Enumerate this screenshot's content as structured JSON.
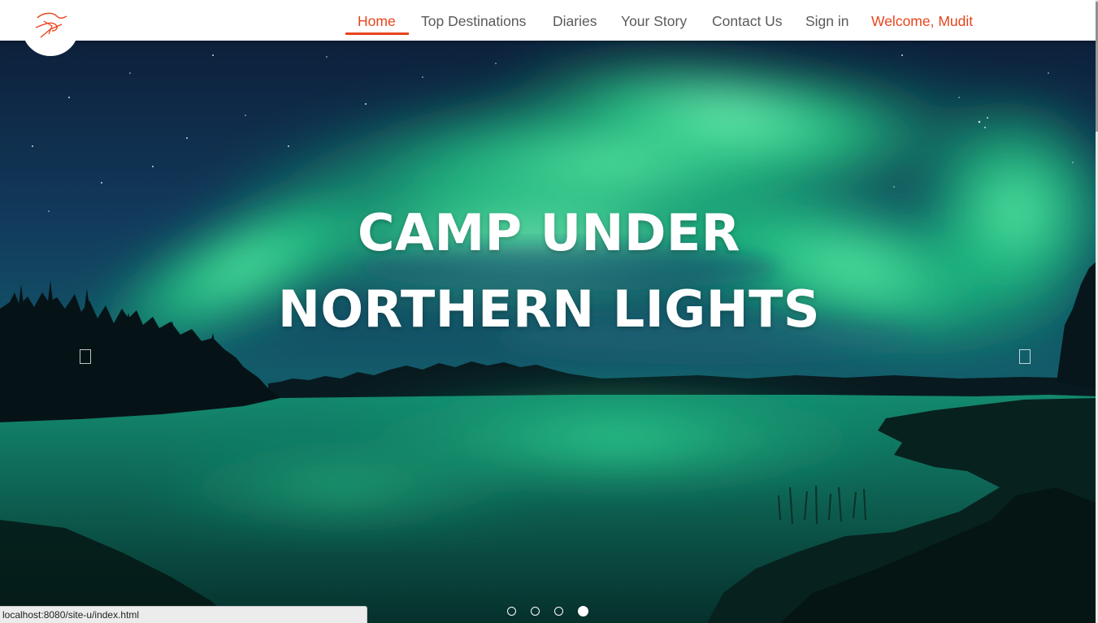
{
  "nav": {
    "items": [
      {
        "label": "Home",
        "active": true
      },
      {
        "label": "Top Destinations",
        "active": false
      },
      {
        "label": "Diaries",
        "active": false
      },
      {
        "label": "Your Story",
        "active": false
      },
      {
        "label": "Contact Us",
        "active": false
      },
      {
        "label": "Sign in",
        "active": false
      }
    ],
    "welcome": "Welcome, Mudit"
  },
  "logo": {
    "icon": "bird-logo-icon"
  },
  "hero": {
    "caption_line1": "CAMP UNDER",
    "caption_line2": "NORTHERN LIGHTS"
  },
  "carousel": {
    "prev_icon": "chevron-left-icon",
    "next_icon": "chevron-right-icon",
    "slide_count": 4,
    "active_index": 3
  },
  "status_bar": {
    "url": "localhost:8080/site-u/index.html"
  },
  "colors": {
    "accent": "#e8441c",
    "nav_text": "#5a5a5a",
    "navbar_bg": "#ffffff"
  }
}
